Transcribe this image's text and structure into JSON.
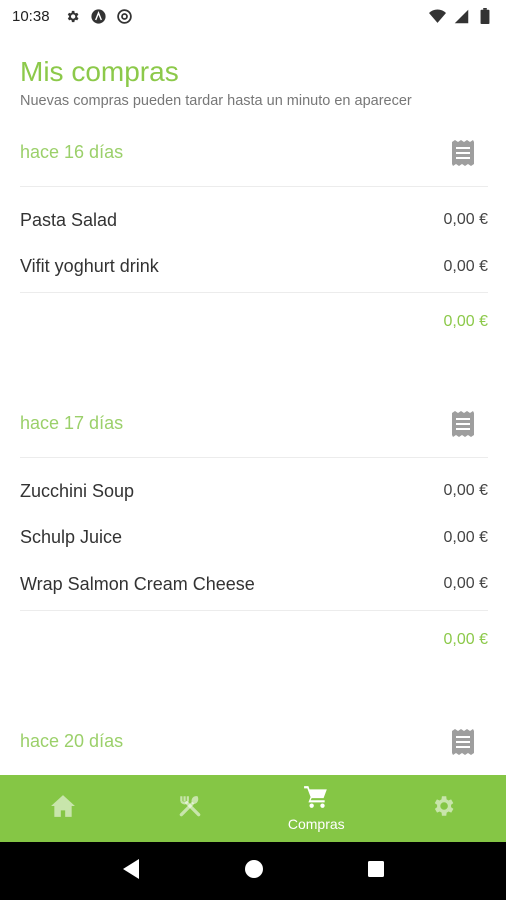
{
  "status_bar": {
    "time": "10:38"
  },
  "header": {
    "title": "Mis compras",
    "subtitle": "Nuevas compras pueden tardar hasta un minuto en aparecer"
  },
  "purchases": [
    {
      "date": "hace 16 días",
      "items": [
        {
          "name": "Pasta Salad",
          "price": "0,00 €"
        },
        {
          "name": "Vifit yoghurt drink",
          "price": "0,00 €"
        }
      ],
      "total": "0,00 €"
    },
    {
      "date": "hace 17 días",
      "items": [
        {
          "name": "Zucchini Soup",
          "price": "0,00 €"
        },
        {
          "name": "Schulp Juice",
          "price": "0,00 €"
        },
        {
          "name": "Wrap Salmon Cream Cheese",
          "price": "0,00 €"
        }
      ],
      "total": "0,00 €"
    },
    {
      "date": "hace 20 días"
    }
  ],
  "bottom_nav": {
    "items": [
      {
        "icon": "home-icon",
        "label": ""
      },
      {
        "icon": "utensils-icon",
        "label": ""
      },
      {
        "icon": "cart-icon",
        "label": "Compras"
      },
      {
        "icon": "gear-icon",
        "label": ""
      }
    ],
    "active_color": "#ffffff",
    "background": "#85c645"
  },
  "colors": {
    "accent": "#8cc94a"
  }
}
